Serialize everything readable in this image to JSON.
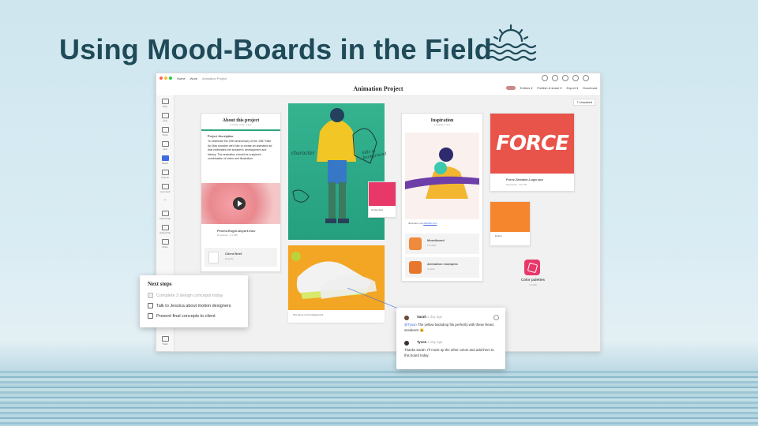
{
  "slide": {
    "title": "Using Mood-Boards in the Field"
  },
  "app": {
    "topbar": {
      "home": "Home",
      "work": "Work",
      "project": "Animation Project"
    },
    "title": "Animation Project",
    "right_menu": [
      "Editors ▾",
      "Publish & share ▾",
      "Export ▾",
      "Download"
    ],
    "unsorted": "7 Unsorted",
    "tools": [
      "Note",
      "Link",
      "To-do",
      "Line",
      "Board",
      "Column",
      "Comment",
      "•••",
      "Add image",
      "Upload file",
      "Draw",
      "Trash"
    ]
  },
  "about_card": {
    "title": "About this project",
    "meta": "2 cards, 1 file, 1 doc",
    "desc_title": "Project description",
    "desc": "To celebrate the 40th anniversary of the 1987 Nike Air Max sneaker we'd like to create an animated ad that celebrates the sneaker's development and history. The animation should be a stylized combination of video and illustration.",
    "video_name": "Pexels-Engin-Akyurt.mov",
    "video_meta": "Download · 3.1 MB",
    "brief_title": "Client Brief",
    "brief_meta": "8 words"
  },
  "illustration": {
    "label_left": "character",
    "label_right": "hills in background",
    "caption": "Tell colors in the background"
  },
  "color_swatch": {
    "label": "Cerise Red",
    "color": "#e8386a"
  },
  "inspiration": {
    "title": "Inspiration",
    "meta": "4 boards, 1 doc",
    "illustrator": "Illustration via",
    "link": "dribbble.com",
    "items": [
      {
        "title": "Moodboard",
        "meta": "11 cards"
      },
      {
        "title": "Animation examples",
        "meta": "4 cards"
      }
    ]
  },
  "force_card": {
    "logo_text": "FORCE",
    "file": "Force-Sneaker-Logo.eps",
    "meta": "Download · 137 KB"
  },
  "ember_card": {
    "label": "Ember",
    "color": "#f5862e"
  },
  "palette": {
    "title": "Color palettes",
    "meta": "6 cards"
  },
  "next_steps": {
    "title": "Next steps",
    "items": [
      {
        "text": "Complete 3 design concepts today",
        "done": true
      },
      {
        "text": "Talk to Jessica about motion designers",
        "done": false
      },
      {
        "text": "Present final concepts to client",
        "done": false
      }
    ]
  },
  "comments": [
    {
      "name": "Sarah",
      "time": "1 day ago",
      "mention": "@Tyson",
      "text": " The yellow backdrop fits perfectly with these React sneakers! 😄"
    },
    {
      "name": "Tyson",
      "time": "1 day ago",
      "text": "Thanks Sarah. I'll mock up the other colors and add them to this board today."
    }
  ],
  "colors": {
    "title": "#1f4a57",
    "accent_teal": "#2fa883",
    "board_blue": "#3d6ae0",
    "force_red": "#e8534a"
  }
}
